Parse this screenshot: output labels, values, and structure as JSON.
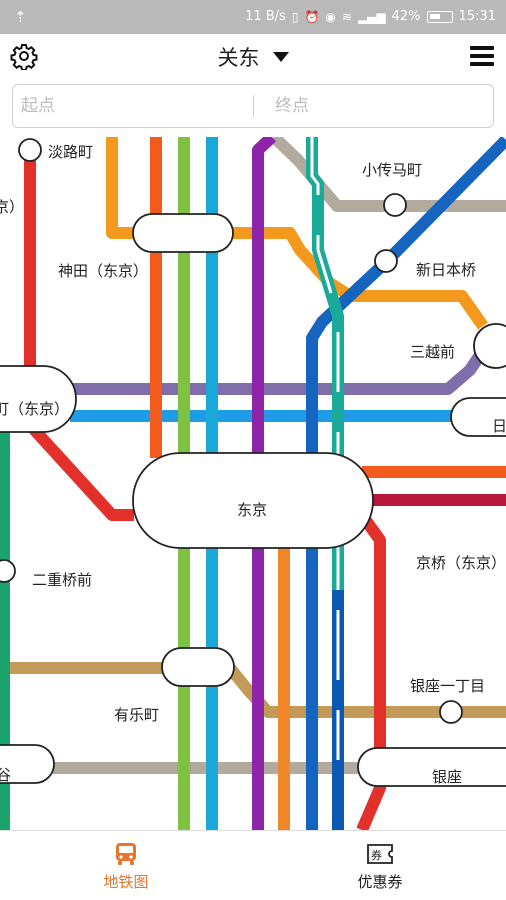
{
  "status_bar": {
    "speed": "11 B/s",
    "battery": "42%",
    "time": "15:31",
    "icons": [
      "usb-icon",
      "vibrate-icon",
      "alarm-icon",
      "eye-icon",
      "wifi-icon",
      "signal-icon",
      "battery-icon"
    ]
  },
  "header": {
    "region": "关东",
    "icons": [
      "gear-icon",
      "dropdown-arrow-icon",
      "menu-icon"
    ]
  },
  "search": {
    "start_placeholder": "起点",
    "end_placeholder": "终点",
    "start_value": "",
    "end_value": ""
  },
  "map": {
    "stations": {
      "awajicho": "淡路町",
      "kodenmacho": "小传马町",
      "kanda": "神田（东京）",
      "shin_nihombashi": "新日本桥",
      "mitsukoshimae": "三越前",
      "otemachi": "町（东京）",
      "nihombashi": "日",
      "tokyo": "东京",
      "nijubashimae": "二重桥前",
      "kyobashi": "京桥（东京）",
      "yurakucho": "有乐町",
      "ginza_itchome": "银座一丁目",
      "hibiya": "谷",
      "ginza": "银座",
      "left_partial": "京）"
    },
    "line_colors": {
      "marunouchi": "#e2302b",
      "ginza": "#f39a1e",
      "chuo": "#f35b1d",
      "yamanote": "#7fc241",
      "keihin_tohoku": "#1aa8d8",
      "hanzomon": "#8f5ba6",
      "tozai": "#1e9ce6",
      "hibiya": "#b2aa9c",
      "chiyoda": "#1aa36b",
      "yurakucho": "#c29b5a",
      "asakusa": "#e73c3f",
      "tokaido": "#f0882a",
      "sobu": "#1565c0",
      "mita": "#0b58b3",
      "keiyo": "#b7173a",
      "joban": "#1aaa9a",
      "purple": "#8e24aa"
    }
  },
  "tabs": [
    {
      "label": "地铁图",
      "icon": "bus-icon",
      "active": true,
      "color": "#e6752e"
    },
    {
      "label": "优惠券",
      "icon": "ticket-icon",
      "active": false,
      "color": "#222222"
    }
  ]
}
